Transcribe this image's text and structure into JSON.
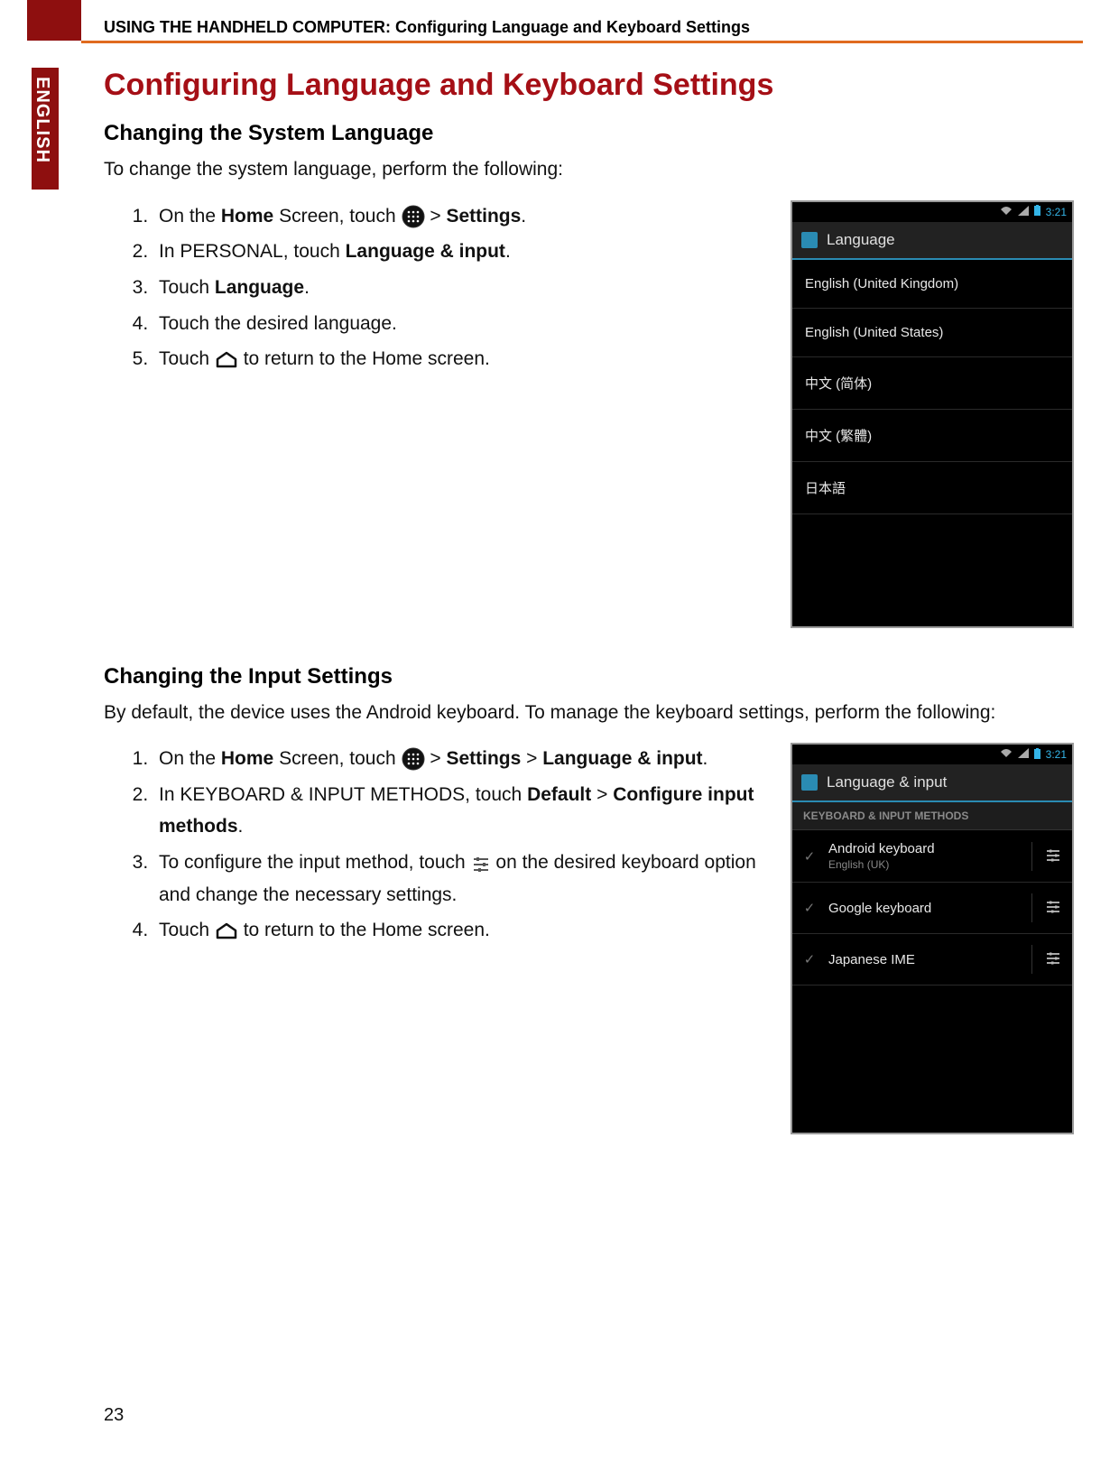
{
  "header": {
    "breadcrumb": "USING THE HANDHELD COMPUTER: Configuring Language and Keyboard Settings",
    "lang_tab": "ENGLISH",
    "page_number": "23"
  },
  "title": "Configuring Language and Keyboard Settings",
  "section1": {
    "title": "Changing the System Language",
    "intro": "To change the system language, perform the following:",
    "steps": {
      "s1a": "On the ",
      "s1b": "Home",
      "s1c": " Screen, touch ",
      "s1d": "  > ",
      "s1e": "Settings",
      "s1f": ".",
      "s2a": "In PERSONAL, touch ",
      "s2b": "Language & input",
      "s2c": ".",
      "s3a": "Touch ",
      "s3b": "Language",
      "s3c": ".",
      "s4": "Touch the desired language.",
      "s5a": "Touch ",
      "s5b": " to return to the Home screen."
    }
  },
  "phone1": {
    "time": "3:21",
    "title": "Language",
    "items": [
      "English (United Kingdom)",
      "English (United States)",
      "中文 (简体)",
      "中文 (繁體)",
      "日本語"
    ]
  },
  "section2": {
    "title": "Changing the Input Settings",
    "intro": "By default, the device uses the Android keyboard. To manage the keyboard settings, perform the following:",
    "steps": {
      "s1a": "On the ",
      "s1b": "Home",
      "s1c": " Screen, touch ",
      "s1d": "  > ",
      "s1e": "Settings",
      "s1f": " > ",
      "s1g": "Language & input",
      "s1h": ".",
      "s2a": "In KEYBOARD & INPUT METHODS, touch ",
      "s2b": "Default",
      "s2c": " > ",
      "s2d": "Configure input methods",
      "s2e": ".",
      "s3a": "To configure the input method, touch  ",
      "s3b": " on the desired keyboard option and change the necessary settings.",
      "s4a": "Touch ",
      "s4b": " to return to the Home screen."
    }
  },
  "phone2": {
    "time": "3:21",
    "title": "Language & input",
    "section_header": "KEYBOARD & INPUT METHODS",
    "items": [
      {
        "name": "Android keyboard",
        "sub": "English (UK)"
      },
      {
        "name": "Google keyboard",
        "sub": ""
      },
      {
        "name": "Japanese IME",
        "sub": ""
      }
    ]
  }
}
